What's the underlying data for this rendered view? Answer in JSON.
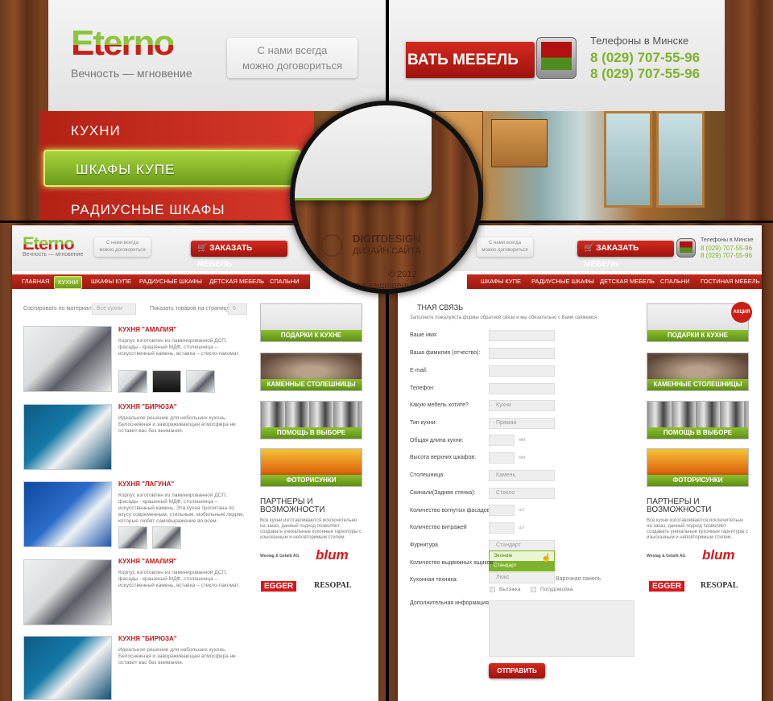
{
  "top_left": {
    "logo_top": "Eterno",
    "tagline": "Вечность — мгновение",
    "bubble_line1": "С нами всегда",
    "bubble_line2": "можно договориться"
  },
  "top_right": {
    "order_button": "ВАТЬ МЕБЕЛЬ",
    "phones_title": "Телефоны в Минске",
    "phone1": "8 (029) 707-55-96",
    "phone2": "8 (029) 707-55-96"
  },
  "big_nav": {
    "items": [
      "КУХНИ",
      "ШКАФЫ КУПЕ",
      "РАДИУСНЫЕ ШКАФЫ"
    ]
  },
  "footer_circle": {
    "brand_line1_a": "DIGIT",
    "brand_line1_b": "DESIGN",
    "brand_line2": "ДИЗАЙН САЙТА",
    "copyright": "© 2012",
    "rights": "Все права защищены"
  },
  "left_page": {
    "logo": "Eterno",
    "tagline": "Вечность — мгновение",
    "bubble_line1": "С нами всегда",
    "bubble_line2": "можно договориться",
    "order_button": "ЗАКАЗАТЬ МЕБЕЛЬ",
    "nav": [
      "ГЛАВНАЯ",
      "КУХНИ",
      "ШКАФЫ КУПЕ",
      "РАДИУСНЫЕ ШКАФЫ",
      "ДЕТСКАЯ МЕБЕЛЬ",
      "СПАЛЬНИ"
    ],
    "filter_label": "Сортировать по материалу:",
    "filter_value": "Все кухни",
    "perpage_label": "Показать товаров на страницу:",
    "perpage_value": "6",
    "products": [
      {
        "title": "КУХНЯ \"АМАЛИЯ\"",
        "desc": "Корпус изготовлен из ламинированной ДСП, фасады - крашеный МДФ, столешница – искусственный камень, вставка – стекло-пакомат."
      },
      {
        "title": "КУХНЯ \"БИРЮЗА\"",
        "desc": "Идеальное решение для небольших кухонь. Белоснежная и завораживающая атмосфера не оставит вас без внимания."
      },
      {
        "title": "КУХНЯ \"ЛАГУНА\"",
        "desc": "Корпус изготовлен из ламинированной ДСП, фасады - крашеный МДФ, столешница – искусственный камень. Эта кухня пропитана по вкусу современным, стильным, мобильным людям, которые любят самовыражение во всем."
      },
      {
        "title": "КУХНЯ \"АМАЛИЯ\"",
        "desc": "Корпус изготовлен из ламинированной ДСП, фасады - крашеный МДФ, столешница – искусственный камень, вставка – стекло-пакомат."
      },
      {
        "title": "КУХНЯ \"БИРЮЗА\"",
        "desc": "Идеальное решение для небольших кухонь. Белоснежная и завораживающая атмосфера не оставит вас без внимания."
      }
    ]
  },
  "sidebar": {
    "banners": [
      "ПОДАРКИ К КУХНЕ",
      "КАМЕННЫЕ СТОЛЕШНИЦЫ",
      "ПОМОЩЬ В ВЫБОРЕ ТЕХНИКИ",
      "ФОТОРИСУНКИ"
    ],
    "promo_badge": "АКЦИЯ",
    "partners_title_1": "ПАРТНЕРЫ И",
    "partners_title_2": "ВОЗМОЖНОСТИ",
    "partners_text": "Все кухни изготавливаются исключительно на заказ, данный подход позволяет создавать уникальные кухонные гарнитуры с изысканным и неповторимым стилем.",
    "partner_logos": [
      "Westag & Getalit AG",
      "blum",
      "EGGER",
      "RESOPAL"
    ]
  },
  "right_page": {
    "order_button": "ЗАКАЗАТЬ МЕБЕЛЬ",
    "bubble_line1": "С нами всегда",
    "bubble_line2": "можно договориться",
    "phones_title": "Телефоны в Минске",
    "phone1": "8 (029) 707-55-96",
    "phone2": "8 (029) 707-55-96",
    "nav": [
      "ШКАФЫ КУПЕ",
      "РАДИУСНЫЕ ШКАФЫ",
      "ДЕТСКАЯ МЕБЕЛЬ",
      "СПАЛЬНИ",
      "ГОСТИНАЯ МЕБЕЛЬ"
    ],
    "form_title": "ТНАЯ СВЯЗЬ",
    "form_subtitle": "Заполните пожалуйста формы обратной связи и мы обязательно с Вами свяжемся",
    "fields": {
      "name": "Ваше имя:",
      "surname": "Ваша фамилия (отчество):",
      "email": "E-mail:",
      "phone": "Телефон:",
      "furniture": "Какую мебель хотите?",
      "kitchen_type": "Тип кухни:",
      "length": "Общая длина кухни:",
      "height": "Высота верхних шкафов:",
      "countertop": "Столешница:",
      "backsplash": "Скинали(Задняя стенка):",
      "cabinets": "Количество вогнутых фасадов:",
      "showcases": "Количество витражей",
      "fittings": "Фурнитура",
      "drawers": "Количество выдвижных ящиков:",
      "appliances": "Кухонная техника:",
      "extra": "Дополнительная информация:"
    },
    "values": {
      "furniture": "Кухни",
      "kitchen_type": "Прямая",
      "countertop": "Камень",
      "backsplash": "Стекло",
      "fittings": "Стандарт",
      "appliances": "Люкс"
    },
    "units": {
      "length": "мм",
      "height": "мм",
      "cabinets": "шт",
      "showcases": "шт"
    },
    "dropdown_options": [
      "Эконом",
      "Стандарт"
    ],
    "appliance_extra": "Варочная панель",
    "check1": "Вытяжка",
    "check2": "Посудомойка",
    "submit": "ОТПРАВИТЬ"
  }
}
